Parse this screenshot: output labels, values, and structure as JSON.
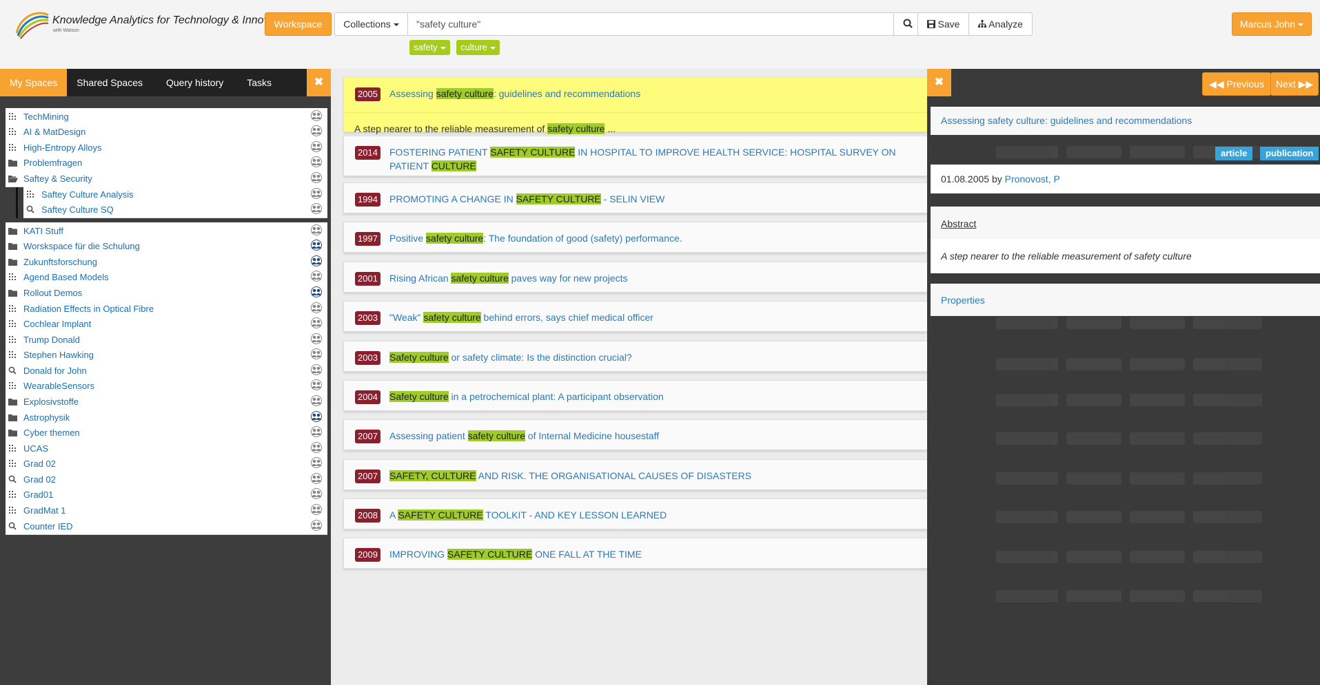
{
  "app": {
    "logo_title": "Knowledge Analytics for Technology & Innovation",
    "logo_sub": "with Watson"
  },
  "topbar": {
    "workspace_label": "Workspace",
    "collections_label": "Collections",
    "search_value": "\"safety culture\"",
    "save_label": "Save",
    "analyze_label": "Analyze",
    "user_label": "Marcus John",
    "chips": [
      "safety",
      "culture"
    ]
  },
  "left": {
    "tabs": [
      "My Spaces",
      "Shared Spaces",
      "Query history",
      "Tasks"
    ],
    "close_label": "✖",
    "items": [
      {
        "label": "TechMining",
        "icon": "grid",
        "share": "gray"
      },
      {
        "label": "AI & MatDesign",
        "icon": "grid",
        "share": "gray"
      },
      {
        "label": "High-Entropy Alloys",
        "icon": "grid",
        "share": "gray"
      },
      {
        "label": "Problemfragen",
        "icon": "folder",
        "share": "gray"
      },
      {
        "label": "Saftey & Security",
        "icon": "folder-open",
        "share": "gray"
      },
      {
        "label": "Saftey Culture Analysis",
        "icon": "grid",
        "share": "gray",
        "sub": true
      },
      {
        "label": "Saftey Culture SQ",
        "icon": "search",
        "share": "gray",
        "sub": true
      },
      {
        "label": "KATI Stuff",
        "icon": "folder",
        "share": "gray"
      },
      {
        "label": "Worskspace für die Schulung",
        "icon": "folder",
        "share": "blue"
      },
      {
        "label": "Zukunftsforschung",
        "icon": "folder",
        "share": "blue"
      },
      {
        "label": "Agend Based Models",
        "icon": "grid",
        "share": "gray"
      },
      {
        "label": "Rollout Demos",
        "icon": "folder",
        "share": "blue"
      },
      {
        "label": "Radiation Effects in Optical Fibre",
        "icon": "grid",
        "share": "gray"
      },
      {
        "label": "Cochlear Implant",
        "icon": "grid",
        "share": "gray"
      },
      {
        "label": "Trump Donald",
        "icon": "grid",
        "share": "gray"
      },
      {
        "label": "Stephen Hawking",
        "icon": "grid",
        "share": "gray"
      },
      {
        "label": "Donald for John",
        "icon": "search",
        "share": "gray"
      },
      {
        "label": "WearableSensors",
        "icon": "grid",
        "share": "gray"
      },
      {
        "label": "Explosivstoffe",
        "icon": "folder",
        "share": "gray"
      },
      {
        "label": "Astrophysik",
        "icon": "folder",
        "share": "blue"
      },
      {
        "label": "Cyber themen",
        "icon": "folder",
        "share": "gray"
      },
      {
        "label": "UCAS",
        "icon": "grid",
        "share": "gray"
      },
      {
        "label": "Grad 02",
        "icon": "grid",
        "share": "gray"
      },
      {
        "label": "Grad 02",
        "icon": "search",
        "share": "gray"
      },
      {
        "label": "Grad01",
        "icon": "grid",
        "share": "gray"
      },
      {
        "label": "GradMat 1",
        "icon": "grid",
        "share": "gray"
      },
      {
        "label": "Counter IED",
        "icon": "search",
        "share": "gray"
      }
    ]
  },
  "results": [
    {
      "year": "2005",
      "parts": [
        [
          "Assessing ",
          0
        ],
        [
          "safety culture",
          1
        ],
        [
          ": guidelines and recommendations",
          0
        ]
      ],
      "snippet": [
        [
          "A step nearer to the reliable measurement of ",
          0
        ],
        [
          "safety culture",
          1
        ],
        [
          " ...",
          0
        ]
      ],
      "selected": true
    },
    {
      "year": "2014",
      "parts": [
        [
          "FOSTERING PATIENT ",
          0
        ],
        [
          "SAFETY CULTURE",
          1
        ],
        [
          " IN HOSPITAL TO IMPROVE HEALTH SERVICE: HOSPITAL SURVEY ON PATIENT ",
          0
        ],
        [
          "CULTURE",
          1
        ]
      ]
    },
    {
      "year": "1994",
      "parts": [
        [
          "PROMOTING A CHANGE IN ",
          0
        ],
        [
          "SAFETY CULTURE",
          1
        ],
        [
          " - SELIN VIEW",
          0
        ]
      ]
    },
    {
      "year": "1997",
      "parts": [
        [
          "Positive ",
          0
        ],
        [
          "safety culture",
          1
        ],
        [
          ": The foundation of good (safety) performance.",
          0
        ]
      ]
    },
    {
      "year": "2001",
      "parts": [
        [
          "Rising African ",
          0
        ],
        [
          "safety culture",
          1
        ],
        [
          " paves way for new projects",
          0
        ]
      ]
    },
    {
      "year": "2003",
      "parts": [
        [
          "\"Weak\" ",
          0
        ],
        [
          "safety culture",
          1
        ],
        [
          " behind errors, says chief medical officer",
          0
        ]
      ]
    },
    {
      "year": "2003",
      "parts": [
        [
          "Safety culture",
          1
        ],
        [
          " or safety climate: Is the distinction crucial?",
          0
        ]
      ]
    },
    {
      "year": "2004",
      "parts": [
        [
          "Safety culture",
          1
        ],
        [
          " in a petrochemical plant: A participant observation",
          0
        ]
      ]
    },
    {
      "year": "2007",
      "parts": [
        [
          "Assessing patient ",
          0
        ],
        [
          "safety culture",
          1
        ],
        [
          " of Internal Medicine housestaff",
          0
        ]
      ]
    },
    {
      "year": "2007",
      "parts": [
        [
          "SAFETY, CULTURE",
          1
        ],
        [
          " AND RISK. THE ORGANISATIONAL CAUSES OF DISASTERS",
          0
        ]
      ]
    },
    {
      "year": "2008",
      "parts": [
        [
          "A ",
          0
        ],
        [
          "SAFETY CULTURE",
          1
        ],
        [
          " TOOLKIT - AND KEY LESSON LEARNED",
          0
        ]
      ]
    },
    {
      "year": "2009",
      "parts": [
        [
          "IMPROVING ",
          0
        ],
        [
          "SAFETY CULTURE",
          1
        ],
        [
          " ONE FALL AT THE TIME",
          0
        ]
      ]
    }
  ],
  "detail": {
    "close_label": "✖",
    "prev_label": "Previous",
    "next_label": "Next",
    "title": "Assessing safety culture: guidelines and recommendations",
    "tags": [
      "article",
      "publication"
    ],
    "date": "01.08.2005",
    "by": "by",
    "author": "Pronovost, P",
    "abstract_label": "Abstract",
    "abstract_text": "A step nearer to the reliable measurement of safety culture",
    "properties_label": "Properties"
  },
  "colors": {
    "accent": "#f7a231",
    "highlight": "#9fcc2a",
    "year_badge": "#8b1f2d",
    "link": "#2b7ab5",
    "tag": "#38a3d9"
  }
}
